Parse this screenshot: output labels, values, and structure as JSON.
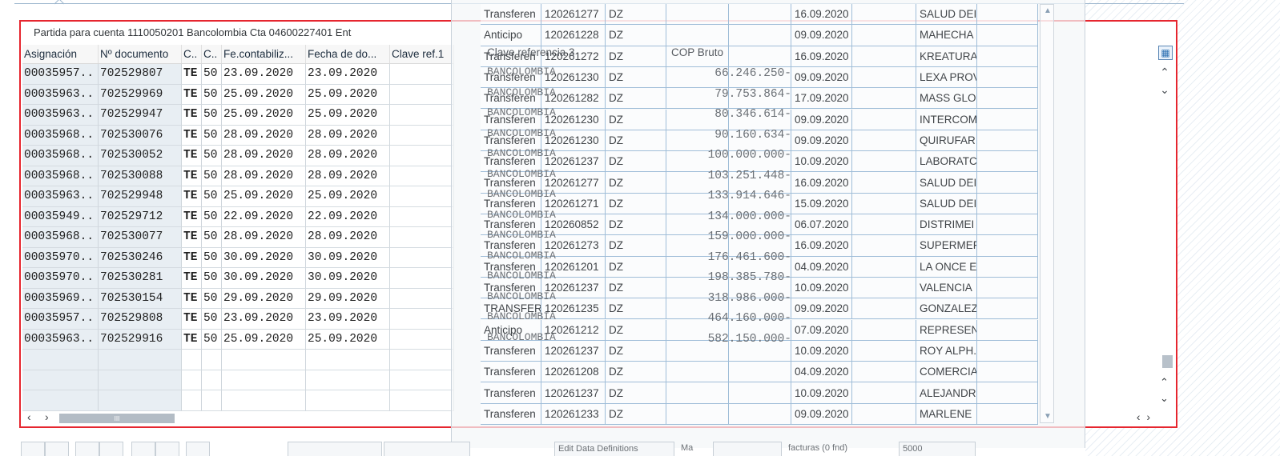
{
  "panel": {
    "title": "Partida para cuenta 1110050201 Bancolombia Cta 04600227401 Ent"
  },
  "columns": [
    "Asignación",
    "Nº documento",
    "C..",
    "C..",
    "Fe.contabiliz...",
    "Fecha de do...",
    "Clave ref.1"
  ],
  "rows": [
    [
      "00035957..",
      "702529807",
      "TE",
      "50",
      "23.09.2020",
      "23.09.2020"
    ],
    [
      "00035963..",
      "702529969",
      "TE",
      "50",
      "25.09.2020",
      "25.09.2020"
    ],
    [
      "00035963..",
      "702529947",
      "TE",
      "50",
      "25.09.2020",
      "25.09.2020"
    ],
    [
      "00035968..",
      "702530076",
      "TE",
      "50",
      "28.09.2020",
      "28.09.2020"
    ],
    [
      "00035968..",
      "702530052",
      "TE",
      "50",
      "28.09.2020",
      "28.09.2020"
    ],
    [
      "00035968..",
      "702530088",
      "TE",
      "50",
      "28.09.2020",
      "28.09.2020"
    ],
    [
      "00035963..",
      "702529948",
      "TE",
      "50",
      "25.09.2020",
      "25.09.2020"
    ],
    [
      "00035949..",
      "702529712",
      "TE",
      "50",
      "22.09.2020",
      "22.09.2020"
    ],
    [
      "00035968..",
      "702530077",
      "TE",
      "50",
      "28.09.2020",
      "28.09.2020"
    ],
    [
      "00035970..",
      "702530246",
      "TE",
      "50",
      "30.09.2020",
      "30.09.2020"
    ],
    [
      "00035970..",
      "702530281",
      "TE",
      "50",
      "30.09.2020",
      "30.09.2020"
    ],
    [
      "00035969..",
      "702530154",
      "TE",
      "50",
      "29.09.2020",
      "29.09.2020"
    ],
    [
      "00035957..",
      "702529808",
      "TE",
      "50",
      "23.09.2020",
      "23.09.2020"
    ],
    [
      "00035963..",
      "702529916",
      "TE",
      "50",
      "25.09.2020",
      "25.09.2020"
    ]
  ],
  "overlay": {
    "header_clave": "Clave referencia 3",
    "header_cop": "COP Bruto",
    "rows": [
      [
        "Transferen",
        "120261277",
        "DZ",
        "16.09.2020",
        "SALUD DEI"
      ],
      [
        "Anticipo",
        "120261228",
        "DZ",
        "09.09.2020",
        "MAHECHA"
      ],
      [
        "Transferen",
        "120261272",
        "DZ",
        "16.09.2020",
        "KREATURA"
      ],
      [
        "Transferen",
        "120261230",
        "DZ",
        "09.09.2020",
        "LEXA PROV"
      ],
      [
        "Transferen",
        "120261282",
        "DZ",
        "17.09.2020",
        "MASS GLO"
      ],
      [
        "Transferen",
        "120261230",
        "DZ",
        "09.09.2020",
        "INTERCOM"
      ],
      [
        "Transferen",
        "120261230",
        "DZ",
        "09.09.2020",
        "QUIRUFAR"
      ],
      [
        "Transferen",
        "120261237",
        "DZ",
        "10.09.2020",
        "LABORATC"
      ],
      [
        "Transferen",
        "120261277",
        "DZ",
        "16.09.2020",
        "SALUD DEI"
      ],
      [
        "Transferen",
        "120261271",
        "DZ",
        "15.09.2020",
        "SALUD DEI"
      ],
      [
        "Transferen",
        "120260852",
        "DZ",
        "06.07.2020",
        "DISTRIMEI"
      ],
      [
        "Transferen",
        "120261273",
        "DZ",
        "16.09.2020",
        "SUPERMEF"
      ],
      [
        "Transferen",
        "120261201",
        "DZ",
        "04.09.2020",
        "LA ONCE E"
      ],
      [
        "Transferen",
        "120261237",
        "DZ",
        "10.09.2020",
        "VALENCIA"
      ],
      [
        "TRANSFER",
        "120261235",
        "DZ",
        "09.09.2020",
        "GONZALEZ"
      ],
      [
        "Anticipo",
        "120261212",
        "DZ",
        "07.09.2020",
        "REPRESEN"
      ],
      [
        "Transferen",
        "120261237",
        "DZ",
        "10.09.2020",
        "ROY ALPH."
      ],
      [
        "Transferen",
        "120261208",
        "DZ",
        "04.09.2020",
        "COMERCIA"
      ],
      [
        "Transferen",
        "120261237",
        "DZ",
        "10.09.2020",
        "ALEJANDR"
      ],
      [
        "Transferen",
        "120261233",
        "DZ",
        "09.09.2020",
        "MARLENE"
      ]
    ],
    "bank_label": "BANCOLOMBIA",
    "amounts": [
      "66.246.250-",
      "79.753.864-",
      "80.346.614-",
      "90.160.634-",
      "100.000.000-",
      "103.251.448-",
      "133.914.646-",
      "134.000.000-",
      "159.000.000-",
      "176.461.600-",
      "198.385.780-",
      "318.986.000-",
      "464.160.000-",
      "582.150.000-"
    ]
  },
  "toolbar": {
    "btn_edit": "Edit Data Definitions",
    "btn_ma": "Ma",
    "btn_facturas": "facturas (0 fnd)",
    "btn_5000": "5000"
  }
}
